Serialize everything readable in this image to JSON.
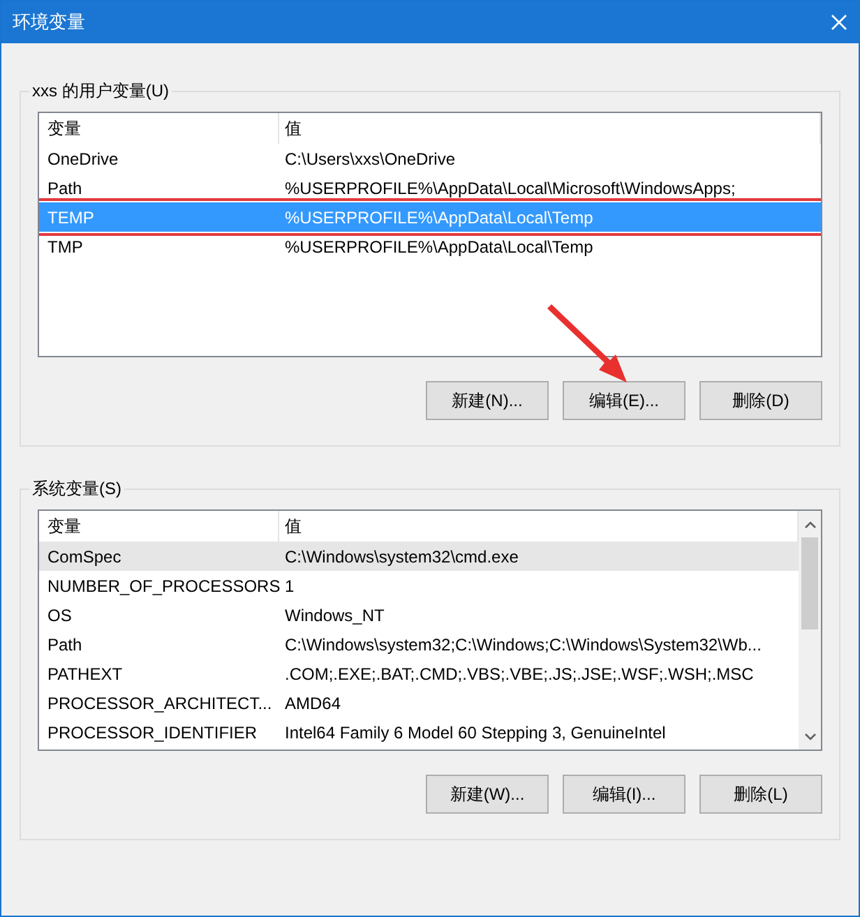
{
  "window": {
    "title": "环境变量"
  },
  "user_variables": {
    "label": "xxs 的用户变量(U)",
    "focused": true,
    "columns": [
      "变量",
      "值"
    ],
    "rows": [
      {
        "name": "OneDrive",
        "value": "C:\\Users\\xxs\\OneDrive",
        "selected": false
      },
      {
        "name": "Path",
        "value": "%USERPROFILE%\\AppData\\Local\\Microsoft\\WindowsApps;",
        "selected": false
      },
      {
        "name": "TEMP",
        "value": "%USERPROFILE%\\AppData\\Local\\Temp",
        "selected": true
      },
      {
        "name": "TMP",
        "value": "%USERPROFILE%\\AppData\\Local\\Temp",
        "selected": false
      }
    ],
    "buttons": [
      "新建(N)...",
      "编辑(E)...",
      "删除(D)"
    ]
  },
  "system_variables": {
    "label": "系统变量(S)",
    "focused": false,
    "columns": [
      "变量",
      "值"
    ],
    "rows": [
      {
        "name": "ComSpec",
        "value": "C:\\Windows\\system32\\cmd.exe",
        "selected": true
      },
      {
        "name": "NUMBER_OF_PROCESSORS",
        "value": "1",
        "selected": false
      },
      {
        "name": "OS",
        "value": "Windows_NT",
        "selected": false
      },
      {
        "name": "Path",
        "value": "C:\\Windows\\system32;C:\\Windows;C:\\Windows\\System32\\Wb...",
        "selected": false
      },
      {
        "name": "PATHEXT",
        "value": ".COM;.EXE;.BAT;.CMD;.VBS;.VBE;.JS;.JSE;.WSF;.WSH;.MSC",
        "selected": false
      },
      {
        "name": "PROCESSOR_ARCHITECT...",
        "value": "AMD64",
        "selected": false
      },
      {
        "name": "PROCESSOR_IDENTIFIER",
        "value": "Intel64 Family 6 Model 60 Stepping 3, GenuineIntel",
        "selected": false
      }
    ],
    "buttons": [
      "新建(W)...",
      "编辑(I)...",
      "删除(L)"
    ]
  }
}
